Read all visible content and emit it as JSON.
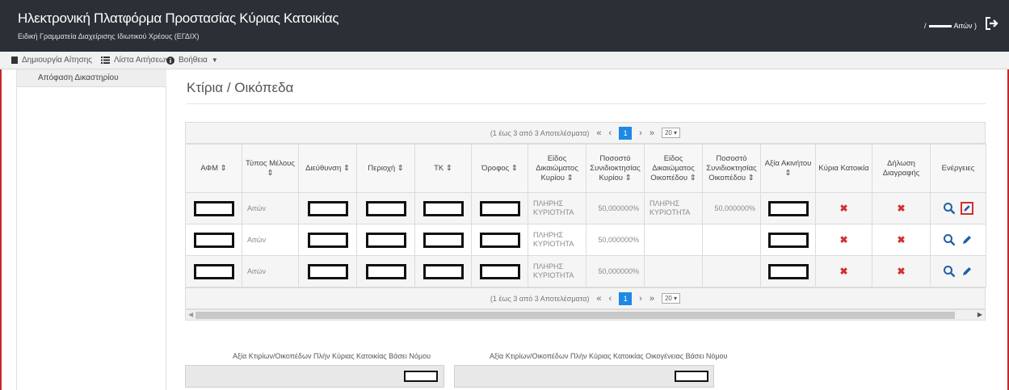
{
  "header": {
    "title": "Ηλεκτρονική Πλατφόρμα Προστασίας Κύριας Κατοικίας",
    "subtitle": "Ειδική Γραμματεία Διαχείρισης Ιδιωτικού Χρέους (ΕΓΔΙΧ)",
    "user_prefix": "/",
    "user_suffix": "Αιτών )"
  },
  "navbar": {
    "create_label": "Δημιουργία Αίτησης",
    "list_label": "Λίστα Αιτήσεων",
    "help_label": "Βοήθεια"
  },
  "sidebar": {
    "items": [
      {
        "label": "Απόφαση Δικαστηρίου"
      }
    ]
  },
  "main": {
    "page_title": "Κτίρια / Οικόπεδα"
  },
  "pager": {
    "summary": "(1 έως 3 από 3 Αποτελέσματα)",
    "first": "«",
    "prev": "‹",
    "current_page": "1",
    "next": "›",
    "last": "»",
    "page_size": "20 ▾"
  },
  "table": {
    "headers": [
      "ΑΦΜ ⇕",
      "Τύπος Μέλους ⇕",
      "Διεύθυνση ⇕",
      "Περιοχή ⇕",
      "ΤΚ ⇕",
      "Όροφος ⇕",
      "Είδος Δικαιώματος Κυρίου ⇕",
      "Ποσοστό Συνιδιοκτησίας Κυρίου ⇕",
      "Είδος Δικαιώματος Οικοπέδου ⇕",
      "Ποσοστό Συνιδιοκτησίας Οικοπέδου ⇕",
      "Αξία Ακινήτου ⇕",
      "Κύρια Κατοικία",
      "Δήλωση Διαγραφής",
      "Ενέργειες"
    ],
    "rows": [
      {
        "member_type": "Αιτών",
        "right_owner": "ΠΛΗΡΗΣ ΚΥΡΙΟΤΗΤΑ",
        "pct_owner": "50,000000%",
        "right_plot": "ΠΛΗΡΗΣ ΚΥΡΙΟΤΗΤΑ",
        "pct_plot": "50,000000%",
        "main_residence": "✖",
        "deletion": "✖"
      },
      {
        "member_type": "Αιτών",
        "right_owner": "ΠΛΗΡΗΣ ΚΥΡΙΟΤΗΤΑ",
        "pct_owner": "50,000000%",
        "right_plot": "",
        "pct_plot": "",
        "main_residence": "✖",
        "deletion": "✖"
      },
      {
        "member_type": "Αιτών",
        "right_owner": "ΠΛΗΡΗΣ ΚΥΡΙΟΤΗΤΑ",
        "pct_owner": "50,000000%",
        "right_plot": "",
        "pct_plot": "",
        "main_residence": "✖",
        "deletion": "✖"
      }
    ]
  },
  "footer_fields": {
    "label_1": "Αξία Κτιρίων/Οικοπέδων Πλήν Κύριας Κατοικίας Βάσει Νόμου",
    "label_2": "Αξία Κτιρίων/Οικοπέδων Πλήν Κύριας Κατοικίας Οικογένειας Βάσει Νόμου"
  },
  "colors": {
    "header_bg": "#2b3036",
    "accent_blue": "#1e88e5",
    "alert_red": "#d32f2f",
    "frame_red": "#c62828"
  },
  "icons": {
    "logout": "logout-icon",
    "create": "document-icon",
    "list": "list-icon",
    "help": "info-circle-icon",
    "view": "magnifier-icon",
    "edit": "pencil-icon",
    "reject": "x-mark-icon"
  }
}
